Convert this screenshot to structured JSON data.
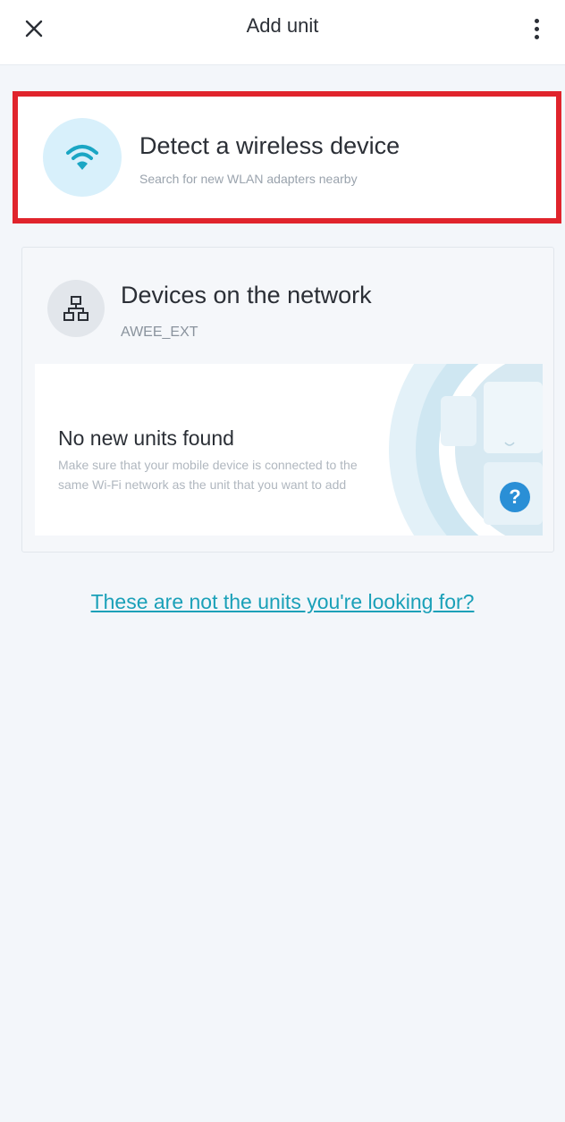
{
  "header": {
    "title": "Add unit",
    "close_icon": "close-icon",
    "menu_icon": "more-vertical-icon"
  },
  "detect_card": {
    "title": "Detect a wireless device",
    "subtitle": "Search for new WLAN adapters nearby",
    "icon": "wifi-icon",
    "highlight_color": "#e0242c",
    "accent_color": "#1aa6c4"
  },
  "network_card": {
    "title": "Devices on the network",
    "network_name": "AWEE_EXT",
    "icon": "network-topology-icon",
    "empty_state": {
      "title": "No new units found",
      "body": "Make sure that your mobile device is connected to the same Wi-Fi network as the unit that you want to add",
      "help_label": "?"
    }
  },
  "footer_link": {
    "label": "These are not the units you're looking for?"
  }
}
